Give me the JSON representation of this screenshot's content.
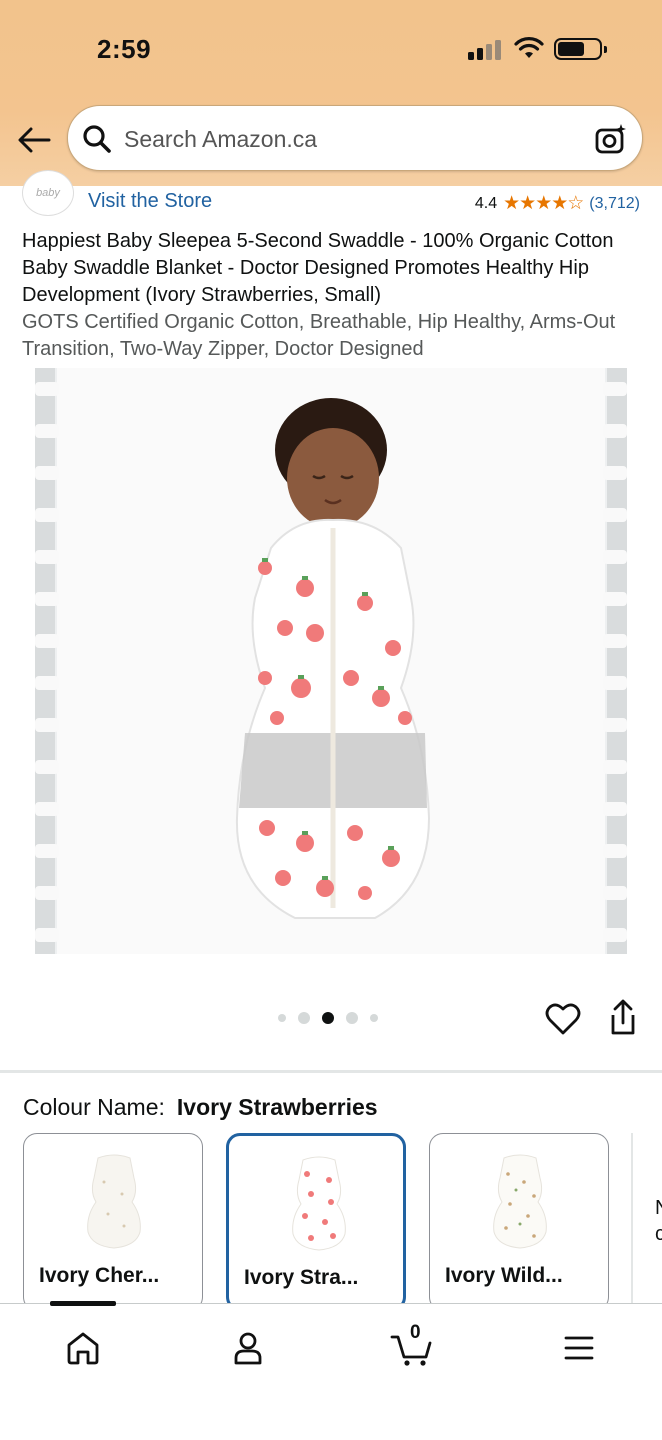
{
  "status_bar": {
    "time": "2:59"
  },
  "search": {
    "placeholder": "Search Amazon.ca"
  },
  "store": {
    "logo_text": "baby",
    "visit_label": "Visit the Store",
    "rating": "4.4",
    "stars": "★★★★☆",
    "rating_count": "(3,712)"
  },
  "product": {
    "title": "Happiest Baby Sleepea 5-Second Swaddle - 100% Organic Cotton Baby Swaddle Blanket - Doctor Designed Promotes Healthy Hip Development (Ivory Strawberries, Small)",
    "subtitle": "GOTS Certified Organic Cotton, Breathable, Hip Healthy, Arms-Out Transition, Two-Way Zipper, Doctor Designed",
    "image_count": 5,
    "active_image_index": 2
  },
  "colour": {
    "label": "Colour Name:",
    "selected": "Ivory Strawberries",
    "options": [
      {
        "label": "Ivory Cher..."
      },
      {
        "label": "Ivory Stra..."
      },
      {
        "label": "Ivory Wild..."
      }
    ],
    "next_peek": "N\nc"
  },
  "bottom_nav": {
    "items": [
      "home-icon",
      "account-icon",
      "cart-icon",
      "menu-icon"
    ],
    "cart_count": "0"
  },
  "colors": {
    "header_bg": "#f3c48f",
    "link": "#2162a1",
    "star": "#e77600",
    "selected_border": "#2162a1"
  }
}
